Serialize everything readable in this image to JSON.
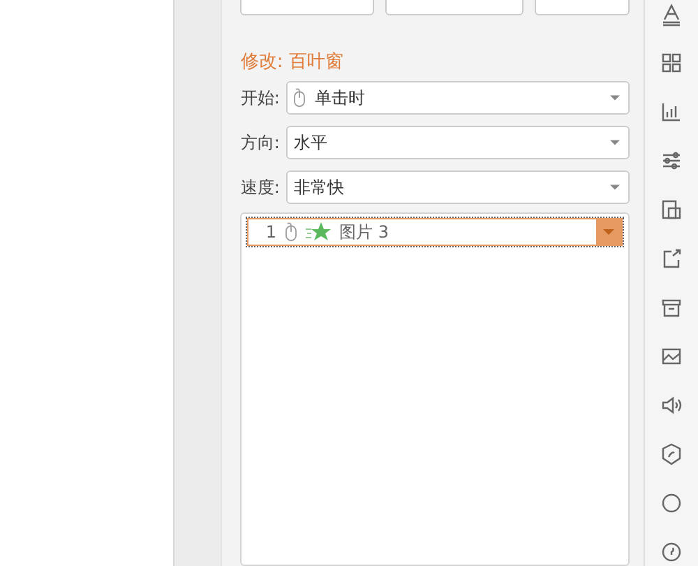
{
  "heading": "修改: 百叶窗",
  "fields": [
    {
      "label": "开始:",
      "value": "单击时",
      "kind": "mouse"
    },
    {
      "label": "方向:",
      "value": "水平",
      "kind": "plain"
    },
    {
      "label": "速度:",
      "value": "非常快",
      "kind": "plain"
    }
  ],
  "animation_list": [
    {
      "index": "1",
      "name": "图片 3",
      "selected": true
    }
  ]
}
